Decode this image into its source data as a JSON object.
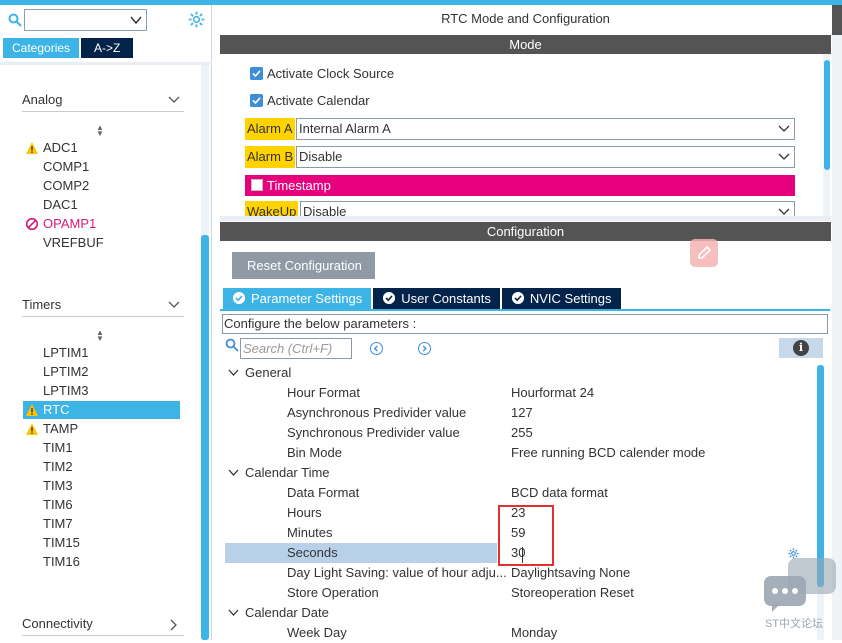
{
  "colors": {
    "accent": "#3cb4e5",
    "navy": "#03234b",
    "warning": "#ffd200",
    "error": "#e6007e",
    "highlight_box": "#e03030"
  },
  "left": {
    "search_placeholder": "",
    "tabs": [
      "Categories",
      "A->Z"
    ],
    "sections": [
      {
        "title": "Analog",
        "items": [
          {
            "label": "ADC1",
            "status": "warning"
          },
          {
            "label": "COMP1",
            "status": ""
          },
          {
            "label": "COMP2",
            "status": ""
          },
          {
            "label": "DAC1",
            "status": ""
          },
          {
            "label": "OPAMP1",
            "status": "error"
          },
          {
            "label": "VREFBUF",
            "status": ""
          }
        ]
      },
      {
        "title": "Timers",
        "items": [
          {
            "label": "LPTIM1",
            "status": ""
          },
          {
            "label": "LPTIM2",
            "status": ""
          },
          {
            "label": "LPTIM3",
            "status": ""
          },
          {
            "label": "RTC",
            "status": "warning",
            "selected": true
          },
          {
            "label": "TAMP",
            "status": "warning"
          },
          {
            "label": "TIM1",
            "status": ""
          },
          {
            "label": "TIM2",
            "status": ""
          },
          {
            "label": "TIM3",
            "status": ""
          },
          {
            "label": "TIM6",
            "status": ""
          },
          {
            "label": "TIM7",
            "status": ""
          },
          {
            "label": "TIM15",
            "status": ""
          },
          {
            "label": "TIM16",
            "status": ""
          }
        ]
      },
      {
        "title": "Connectivity",
        "items": []
      }
    ]
  },
  "right": {
    "title": "RTC Mode and Configuration",
    "mode_bar": "Mode",
    "mode": {
      "checks": [
        "Activate Clock Source",
        "Activate Calendar"
      ],
      "rows": [
        {
          "label": "Alarm A",
          "value": "Internal Alarm A"
        },
        {
          "label": "Alarm B",
          "value": "Disable"
        }
      ],
      "timestamp": "Timestamp",
      "wakeup": {
        "label": "WakeUp",
        "value": "Disable"
      }
    },
    "config_bar": "Configuration",
    "reset_button": "Reset Configuration",
    "tabs": [
      "Parameter Settings",
      "User Constants",
      "NVIC Settings"
    ],
    "config_hint": "Configure the below parameters :",
    "search_placeholder": "Search (Ctrl+F)",
    "groups": [
      {
        "name": "General",
        "params": [
          {
            "name": "Hour Format",
            "value": "Hourformat 24"
          },
          {
            "name": "Asynchronous Predivider value",
            "value": "127"
          },
          {
            "name": "Synchronous Predivider value",
            "value": "255"
          },
          {
            "name": "Bin Mode",
            "value": "Free running BCD calender mode"
          }
        ]
      },
      {
        "name": "Calendar Time",
        "params": [
          {
            "name": "Data Format",
            "value": "BCD data format"
          },
          {
            "name": "Hours",
            "value": "23"
          },
          {
            "name": "Minutes",
            "value": "59"
          },
          {
            "name": "Seconds",
            "value": "30"
          },
          {
            "name": "Day Light Saving: value of hour adju...",
            "value": "Daylightsaving None"
          },
          {
            "name": "Store Operation",
            "value": "Storeoperation Reset"
          }
        ]
      },
      {
        "name": "Calendar Date",
        "params": [
          {
            "name": "Week Day",
            "value": "Monday"
          }
        ]
      }
    ]
  },
  "watermark": "ST中文论坛"
}
